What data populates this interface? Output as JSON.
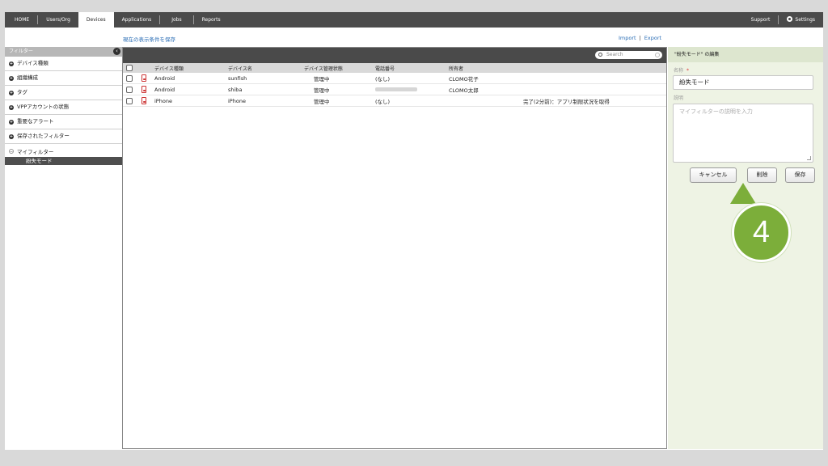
{
  "nav": {
    "items": [
      "HOME",
      "Users/Org",
      "Devices",
      "Applications",
      "Jobs",
      "Reports"
    ],
    "active": "Devices",
    "support": "Support",
    "settings": "Settings"
  },
  "toolbar": {
    "save_conditions": "現在の表示条件を保存",
    "import": "Import",
    "separator": "|",
    "export": "Export"
  },
  "sidebar": {
    "title": "フィルター",
    "items": [
      "デバイス種類",
      "組織構成",
      "タグ",
      "VPPアカウントの状態",
      "重要なアラート",
      "保存されたフィルター"
    ],
    "my_filter": "マイフィルター",
    "my_filter_selected": "紛失モード"
  },
  "search": {
    "placeholder": "Search"
  },
  "table": {
    "headers": [
      "デバイス種類",
      "デバイス名",
      "デバイス管理状態",
      "電話番号",
      "所有者"
    ],
    "rows": [
      {
        "type": "Android",
        "name": "sunfish",
        "state": "管理中",
        "phone": "(なし)",
        "owner": "CLOMO花子",
        "status": ""
      },
      {
        "type": "Android",
        "name": "shiba",
        "state": "管理中",
        "phone": "",
        "owner": "CLOMO太郎",
        "status": ""
      },
      {
        "type": "iPhone",
        "name": "iPhone",
        "state": "管理中",
        "phone": "(なし)",
        "owner": "",
        "status": "完了(2分前)：アプリ制限状況を取得"
      }
    ]
  },
  "editor": {
    "title": "\"紛失モード\" の編集",
    "name_label": "名称",
    "required_mark": "*",
    "name_value": "紛失モード",
    "desc_label": "説明",
    "desc_placeholder": "マイフィルターの説明を入力",
    "cancel": "キャンセル",
    "delete": "削除",
    "save": "保存"
  },
  "step_badge": "4",
  "colors": {
    "nav_bg": "#4b4b4b",
    "accent_green": "#7cae3a",
    "link_blue": "#2a6db5"
  }
}
